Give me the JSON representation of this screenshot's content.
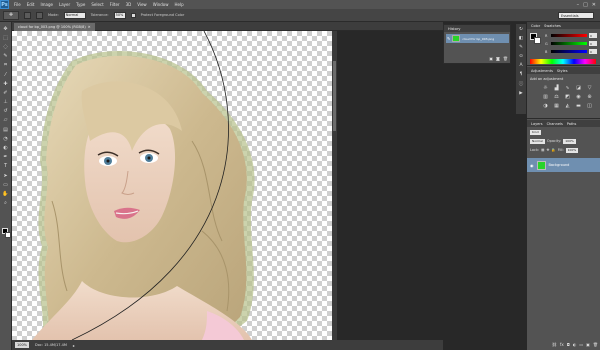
{
  "app": {
    "logo": "Ps",
    "menus": [
      "File",
      "Edit",
      "Image",
      "Layer",
      "Type",
      "Select",
      "Filter",
      "3D",
      "View",
      "Window",
      "Help"
    ],
    "window_controls": [
      "–",
      "□",
      "✕"
    ]
  },
  "options_bar": {
    "tool_icon": "healing-brush-icon",
    "mode_label": "Mode:",
    "mode_value": "Normal",
    "tolerance_label": "Tolerance:",
    "tolerance_value": "50%",
    "protect_fg_label": "Protect Foreground Color",
    "workspace": "Essentials"
  },
  "document": {
    "tab_title": "cloud for bp_003.png @ 100% (RGB/8)",
    "zoom": "100%",
    "doc_size": "Doc: 15.4M/17.4M"
  },
  "history_panel": {
    "tabs": [
      "History"
    ],
    "item_label": "cloud for bp_003.png"
  },
  "color_panel": {
    "tabs": [
      "Color",
      "Swatches"
    ],
    "channels": [
      {
        "label": "R",
        "value": "0"
      },
      {
        "label": "G",
        "value": "0"
      },
      {
        "label": "B",
        "value": "0"
      }
    ]
  },
  "adjustments_panel": {
    "tabs": [
      "Adjustments",
      "Styles"
    ],
    "title": "Add an adjustment"
  },
  "layers_panel": {
    "tabs": [
      "Layers",
      "Channels",
      "Paths"
    ],
    "kind_label": "Kind",
    "blend_mode": "Normal",
    "opacity_label": "Opacity:",
    "opacity_value": "100%",
    "lock_label": "Lock:",
    "fill_label": "Fill:",
    "fill_value": "100%",
    "layer_name": "Background"
  },
  "colors": {
    "ui_bg": "#535353",
    "workspace_bg": "#282828",
    "selection_blue": "#6f8fb0",
    "layer_thumb_green": "#29d429"
  }
}
